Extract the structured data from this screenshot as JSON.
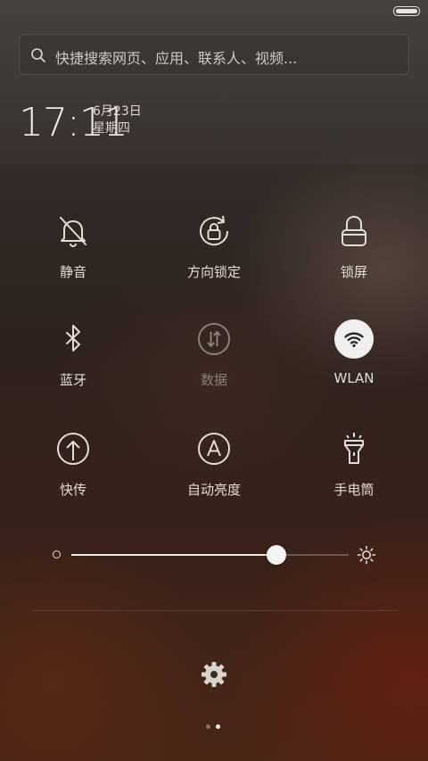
{
  "status_bar": {
    "battery_level": 1.0
  },
  "search": {
    "placeholder": "快捷搜索网页、应用、联系人、视频..."
  },
  "clock": {
    "time": "17:11",
    "date": "6月23日",
    "weekday": "星期四"
  },
  "toggles": [
    {
      "label": "静音",
      "icon": "bell-off-icon",
      "active": false,
      "enabled": true
    },
    {
      "label": "方向锁定",
      "icon": "rotation-lock-icon",
      "active": false,
      "enabled": true
    },
    {
      "label": "锁屏",
      "icon": "lock-icon",
      "active": false,
      "enabled": true
    },
    {
      "label": "蓝牙",
      "icon": "bluetooth-icon",
      "active": false,
      "enabled": true
    },
    {
      "label": "数据",
      "icon": "mobile-data-icon",
      "active": false,
      "enabled": false
    },
    {
      "label": "WLAN",
      "icon": "wifi-icon",
      "active": true,
      "enabled": true
    },
    {
      "label": "快传",
      "icon": "quick-transfer-icon",
      "active": false,
      "enabled": true
    },
    {
      "label": "自动亮度",
      "icon": "auto-brightness-icon",
      "active": false,
      "enabled": true
    },
    {
      "label": "手电筒",
      "icon": "flashlight-icon",
      "active": false,
      "enabled": true
    }
  ],
  "brightness": {
    "level": 0.74
  },
  "pager": {
    "count": 2,
    "current": 1
  },
  "colors": {
    "accent": "#f1efed",
    "text": "#e3dcd6",
    "disabled": "#8a7f79"
  }
}
